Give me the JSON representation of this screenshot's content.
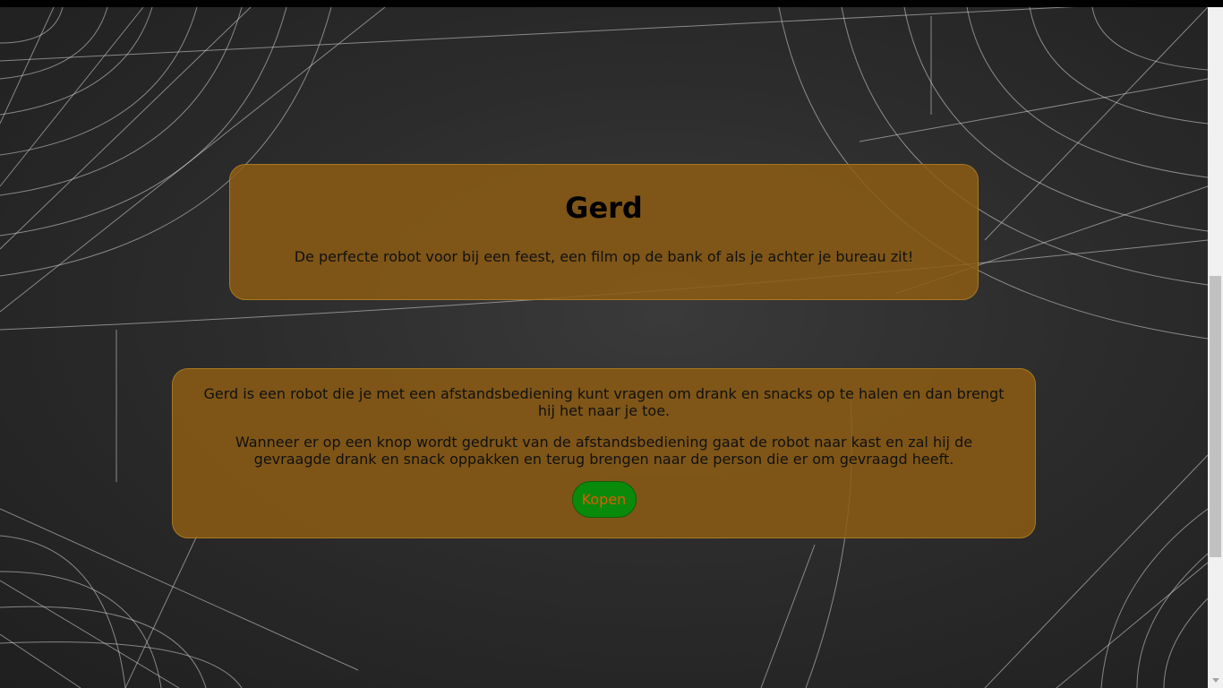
{
  "hero": {
    "title": "Gerd",
    "subtitle": "De perfecte robot voor bij een feest, een film op de bank of als je achter je bureau zit!"
  },
  "info": {
    "paragraph_1": "Gerd is een robot die je met een afstandsbediening kunt vragen om drank en snacks op te halen en dan brengt hij het naar je toe.",
    "paragraph_2": "Wanneer er op een knop wordt gedrukt van de afstandsbediening gaat de robot naar kast en zal hij de gevraagde drank en snack oppakken en terug brengen naar de person die er om gevraagd heeft.",
    "button_label": "Kopen"
  },
  "background": {
    "icon": "spiderweb-pattern",
    "color": "#2a2a2a",
    "web_color": "#d8d8d8"
  },
  "colors": {
    "card_bg": "#8c5c14",
    "button_bg": "#0a8a0a",
    "button_text": "#e05a0a"
  }
}
